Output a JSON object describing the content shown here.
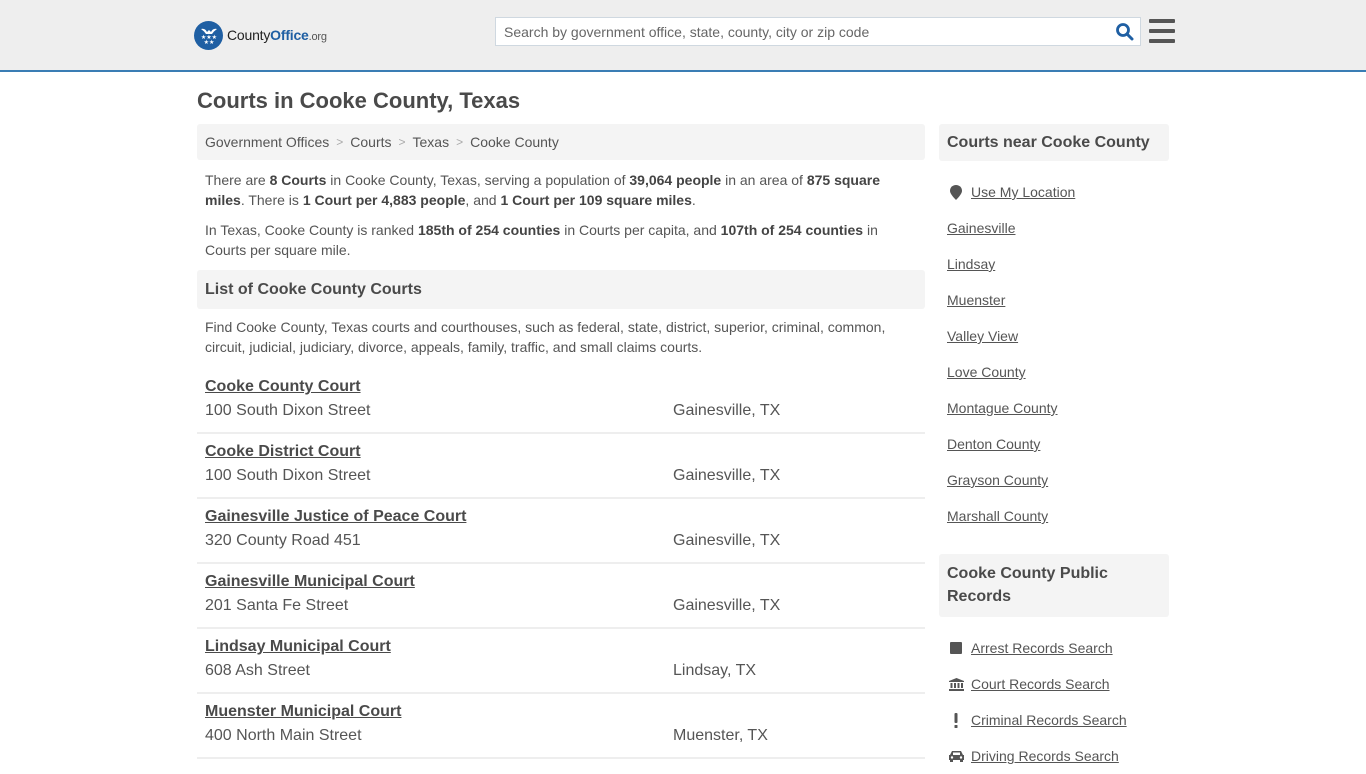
{
  "header": {
    "logo": {
      "part1": "County",
      "part2": "Office",
      "part3": ".org"
    },
    "search": {
      "placeholder": "Search by government office, state, county, city or zip code",
      "value": ""
    },
    "colors": {
      "brand": "#1f5fa3",
      "border": "#3a7db4"
    }
  },
  "page": {
    "title": "Courts in Cooke County, Texas"
  },
  "breadcrumb": [
    {
      "label": "Government Offices"
    },
    {
      "label": "Courts"
    },
    {
      "label": "Texas"
    },
    {
      "label": "Cooke County"
    }
  ],
  "intro": {
    "p1": {
      "t1": "There are ",
      "b1": "8 Courts",
      "t2": " in Cooke County, Texas, serving a population of ",
      "b2": "39,064 people",
      "t3": " in an area of ",
      "b3": "875 square miles",
      "t4": ". There is ",
      "b4": "1 Court per 4,883 people",
      "t5": ", and ",
      "b5": "1 Court per 109 square miles",
      "t6": "."
    },
    "p2": {
      "t1": "In Texas, Cooke County is ranked ",
      "b1": "185th of 254 counties",
      "t2": " in Courts per capita, and ",
      "b2": "107th of 254 counties",
      "t3": " in Courts per square mile."
    }
  },
  "list": {
    "heading": "List of Cooke County Courts",
    "description": "Find Cooke County, Texas courts and courthouses, such as federal, state, district, superior, criminal, common, circuit, judicial, judiciary, divorce, appeals, family, traffic, and small claims courts.",
    "courts": [
      {
        "name": "Cooke County Court",
        "address": "100 South Dixon Street",
        "city": "Gainesville, TX"
      },
      {
        "name": "Cooke District Court",
        "address": "100 South Dixon Street",
        "city": "Gainesville, TX"
      },
      {
        "name": "Gainesville Justice of Peace Court",
        "address": "320 County Road 451",
        "city": "Gainesville, TX"
      },
      {
        "name": "Gainesville Municipal Court",
        "address": "201 Santa Fe Street",
        "city": "Gainesville, TX"
      },
      {
        "name": "Lindsay Municipal Court",
        "address": "608 Ash Street",
        "city": "Lindsay, TX"
      },
      {
        "name": "Muenster Municipal Court",
        "address": "400 North Main Street",
        "city": "Muenster, TX"
      }
    ]
  },
  "sidebar": {
    "nearby": {
      "heading": "Courts near Cooke County",
      "use_location": {
        "label": "Use My Location",
        "icon": "map-pin-icon"
      },
      "links": [
        {
          "label": "Gainesville"
        },
        {
          "label": "Lindsay"
        },
        {
          "label": "Muenster"
        },
        {
          "label": "Valley View"
        },
        {
          "label": "Love County"
        },
        {
          "label": "Montague County"
        },
        {
          "label": "Denton County"
        },
        {
          "label": "Grayson County"
        },
        {
          "label": "Marshall County"
        }
      ]
    },
    "records": {
      "heading": "Cooke County Public Records",
      "links": [
        {
          "label": "Arrest Records Search",
          "icon": "square-icon"
        },
        {
          "label": "Court Records Search",
          "icon": "courthouse-icon"
        },
        {
          "label": "Criminal Records Search",
          "icon": "exclamation-icon"
        },
        {
          "label": "Driving Records Search",
          "icon": "car-icon"
        }
      ]
    }
  }
}
